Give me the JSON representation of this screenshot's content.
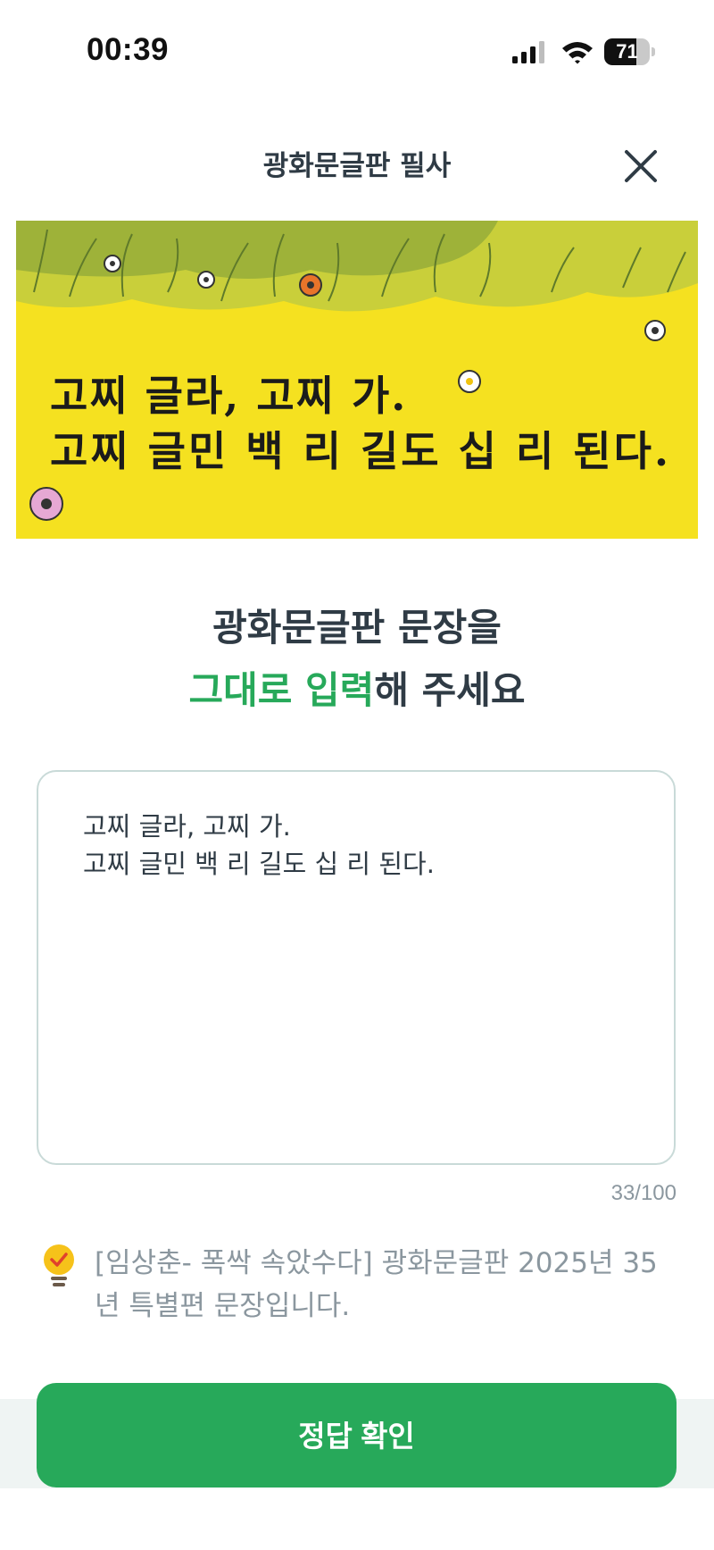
{
  "status_bar": {
    "time": "00:39",
    "battery_level": "71",
    "battery_fraction": 0.71,
    "icons": [
      "cellular-signal-icon",
      "wifi-icon",
      "battery-icon"
    ]
  },
  "header": {
    "title": "광화문글판 필사",
    "close_icon": "close-icon"
  },
  "banner": {
    "line1": "고찌 글라, 고찌 가.",
    "line2": "고찌 글민 백 리 길도 십 리 된다."
  },
  "instruction": {
    "line1": "광화문글판 문장을",
    "highlight": "그대로 입력",
    "suffix": "해 주세요"
  },
  "answer": {
    "value": "고찌 글라, 고찌 가.\n고찌 글민 백 리 길도 십 리 된다.",
    "counter": "33/100"
  },
  "hint": {
    "icon": "lightbulb-icon",
    "text": "[임상춘- 폭싹 속았수다] 광화문글판 2025년 35년 특별편 문장입니다."
  },
  "actions": {
    "confirm_label": "정답 확인"
  },
  "colors": {
    "accent": "#27a95a",
    "text": "#2f3b45",
    "muted": "#8b979f",
    "banner_bg": "#f5e120",
    "border": "#c9dad8"
  }
}
